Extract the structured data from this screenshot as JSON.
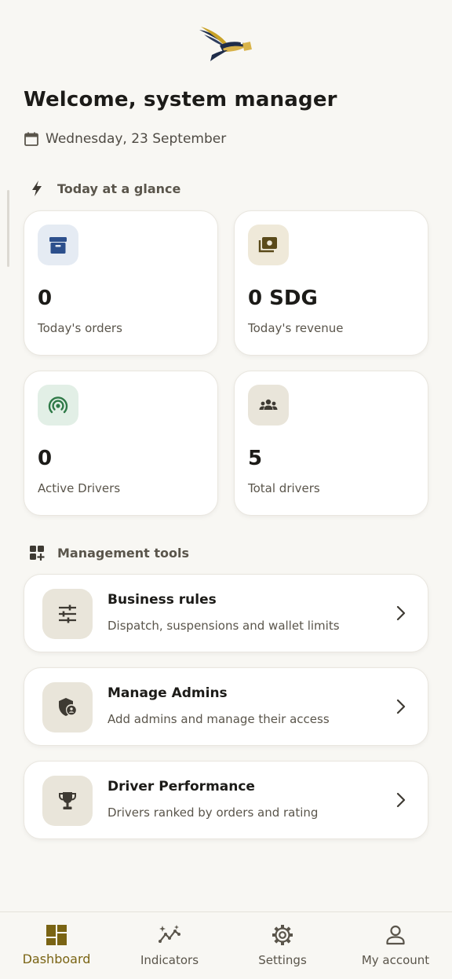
{
  "header": {
    "welcome": "Welcome, system manager",
    "date": "Wednesday, 23 September"
  },
  "glance": {
    "title": "Today at a glance",
    "cards": [
      {
        "value": "0",
        "label": "Today's orders",
        "icon": "archive-box-icon",
        "icon_bg": "#e5ebf3",
        "icon_color": "#2c4f8c"
      },
      {
        "value": "0 SDG",
        "label": "Today's revenue",
        "icon": "money-icon",
        "icon_bg": "#efe9d9",
        "icon_color": "#5a4a1a"
      },
      {
        "value": "0",
        "label": "Active Drivers",
        "icon": "live-signal-icon",
        "icon_bg": "#e2efe6",
        "icon_color": "#2f7a48"
      },
      {
        "value": "5",
        "label": "Total drivers",
        "icon": "group-icon",
        "icon_bg": "#e9e5da",
        "icon_color": "#3e3a33"
      }
    ]
  },
  "tools": {
    "title": "Management tools",
    "items": [
      {
        "title": "Business rules",
        "subtitle": "Dispatch, suspensions and wallet limits",
        "icon": "sliders-icon"
      },
      {
        "title": "Manage Admins",
        "subtitle": "Add admins and manage their access",
        "icon": "admin-shield-icon"
      },
      {
        "title": "Driver Performance",
        "subtitle": "Drivers ranked by orders and rating",
        "icon": "trophy-icon"
      }
    ]
  },
  "nav": {
    "items": [
      {
        "label": "Dashboard",
        "icon": "dashboard-icon",
        "active": true
      },
      {
        "label": "Indicators",
        "icon": "indicators-icon",
        "active": false
      },
      {
        "label": "Settings",
        "icon": "settings-icon",
        "active": false
      },
      {
        "label": "My account",
        "icon": "account-icon",
        "active": false
      }
    ]
  },
  "colors": {
    "background": "#f8f7f3",
    "accent": "#7a6414",
    "text": "#1c1b18",
    "muted": "#5a554b"
  }
}
